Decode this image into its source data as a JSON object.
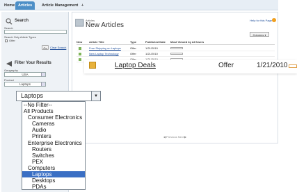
{
  "tabs": [
    {
      "label": "Home"
    },
    {
      "label": "Articles"
    },
    {
      "label": "Article Management"
    },
    {
      "label": "+"
    }
  ],
  "search": {
    "title": "Search",
    "search_label": "Search",
    "types_label": "Search Only Article Types",
    "offer_label": "Offer",
    "go_label": "Go",
    "clear_label": "Clear Search"
  },
  "filter": {
    "title": "Filter Your Results",
    "geography_label": "Geography",
    "geography_value": "USA",
    "product_label": "Product",
    "product_value": "Laptops"
  },
  "main": {
    "section_label": "Articles",
    "title": "New Articles",
    "help_label": "Help for this Page",
    "columns_button": "Columns ▾",
    "headers": [
      "New",
      "Article Title",
      "Type",
      "Published Date",
      "Most Viewed by All Users"
    ],
    "rows": [
      {
        "title": "Free Shipping on Laptops",
        "type": "Offer",
        "date": "1/21/2010"
      },
      {
        "title": "New Laptop Technology",
        "type": "Offer",
        "date": "1/21/2010"
      },
      {
        "title": "",
        "type": "Offer",
        "date": "1/21/2010"
      }
    ],
    "pager": "◀ Previous  Next ▶"
  },
  "zoom_row": {
    "title": "Laptop Deals",
    "type": "Offer",
    "date": "1/21/2010"
  },
  "dropdown": {
    "selected": "Laptops",
    "options": [
      {
        "label": "--No Filter--",
        "level": 0
      },
      {
        "label": "All Products",
        "level": 0
      },
      {
        "label": "Consumer Electronics",
        "level": 1
      },
      {
        "label": "Cameras",
        "level": 2
      },
      {
        "label": "Audio",
        "level": 2
      },
      {
        "label": "Printers",
        "level": 2
      },
      {
        "label": "Enterprise Electronics",
        "level": 1
      },
      {
        "label": "Routers",
        "level": 2
      },
      {
        "label": "Switches",
        "level": 2
      },
      {
        "label": "PEX",
        "level": 2
      },
      {
        "label": "Computers",
        "level": 1
      },
      {
        "label": "Laptops",
        "level": 2,
        "selected": true
      },
      {
        "label": "Desktops",
        "level": 2
      },
      {
        "label": "PDAs",
        "level": 2
      }
    ]
  },
  "colors": {
    "accent": "#4d8fc7",
    "selection": "#3a6fc4"
  }
}
